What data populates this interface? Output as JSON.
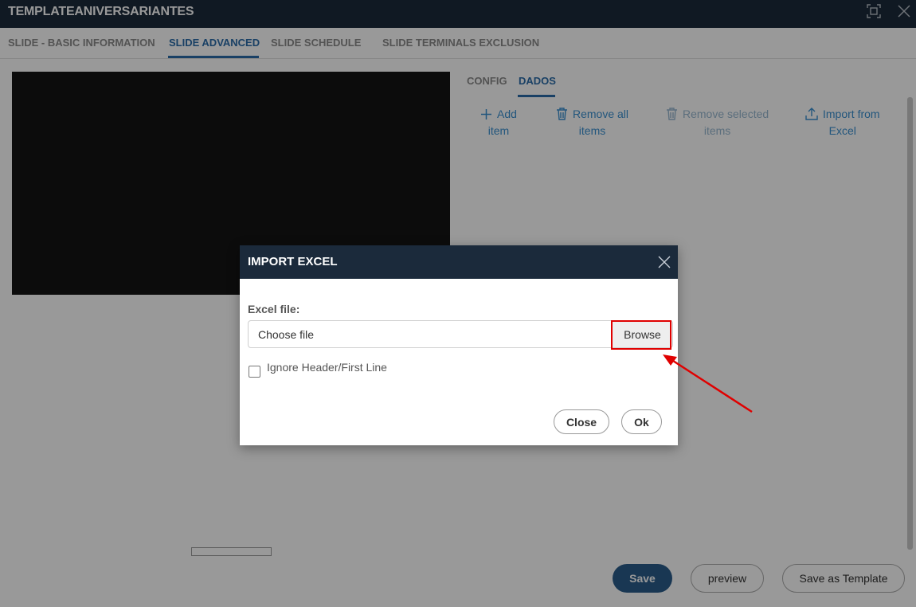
{
  "window": {
    "title": "TEMPLATEANIVERSARIANTES",
    "icons": [
      "maximize-icon",
      "close-icon"
    ]
  },
  "tabs": [
    {
      "label": "SLIDE - BASIC INFORMATION",
      "active": false
    },
    {
      "label": "SLIDE ADVANCED",
      "active": true
    },
    {
      "label": "SLIDE SCHEDULE",
      "active": false
    },
    {
      "label": "SLIDE TERMINALS EXCLUSION",
      "active": false
    }
  ],
  "subtabs": [
    {
      "label": "CONFIG",
      "active": false
    },
    {
      "label": "DADOS",
      "active": true
    }
  ],
  "toolbar": {
    "add_item": {
      "line1": "Add",
      "line2": "item",
      "icon": "plus-icon"
    },
    "remove_all": {
      "line1": "Remove all",
      "line2": "items",
      "icon": "trash-icon"
    },
    "remove_selected": {
      "line1": "Remove selected",
      "line2": "items",
      "icon": "trash-icon",
      "disabled": true
    },
    "import_excel": {
      "line1": "Import from",
      "line2": "Excel",
      "icon": "upload-icon"
    }
  },
  "footer": {
    "save_label": "Save",
    "preview_label": "preview",
    "save_template_label": "Save as Template"
  },
  "dialog": {
    "title": "IMPORT EXCEL",
    "field_label": "Excel file:",
    "file_placeholder": "Choose file",
    "browse_label": "Browse",
    "checkbox_label": "Ignore Header/First Line",
    "checkbox_checked": false,
    "close_label": "Close",
    "ok_label": "Ok"
  },
  "colors": {
    "header_bg": "#1b2a3b",
    "accent": "#2a6ca8",
    "save_button": "#2b5d8a",
    "highlight": "#e00000"
  }
}
